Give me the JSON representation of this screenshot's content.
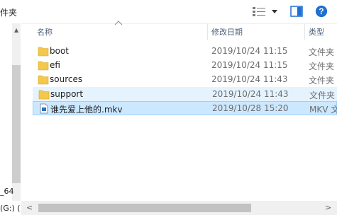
{
  "toolbar": {
    "title": "件夹"
  },
  "nav": {
    "fragment_1": "_64",
    "fragment_2": "(G:) ("
  },
  "columns": {
    "name": "名称",
    "modified": "修改日期",
    "type": "类型"
  },
  "files": [
    {
      "name": "boot",
      "modified": "2019/10/24 11:15",
      "type": "文件夹",
      "icon": "folder-icon"
    },
    {
      "name": "efi",
      "modified": "2019/10/24 11:15",
      "type": "文件夹",
      "icon": "folder-icon"
    },
    {
      "name": "sources",
      "modified": "2019/10/24 11:43",
      "type": "文件夹",
      "icon": "folder-icon"
    },
    {
      "name": "support",
      "modified": "2019/10/24 11:43",
      "type": "文件夹",
      "icon": "folder-icon"
    },
    {
      "name": "谁先爱上他的.mkv",
      "modified": "2019/10/28 15:20",
      "type": "MKV 文",
      "icon": "video-file-icon"
    }
  ],
  "colors": {
    "folder": "#f3c84b",
    "selection": "#cce8ff",
    "hover": "#e5f3ff",
    "help": "#1e6fd0"
  }
}
